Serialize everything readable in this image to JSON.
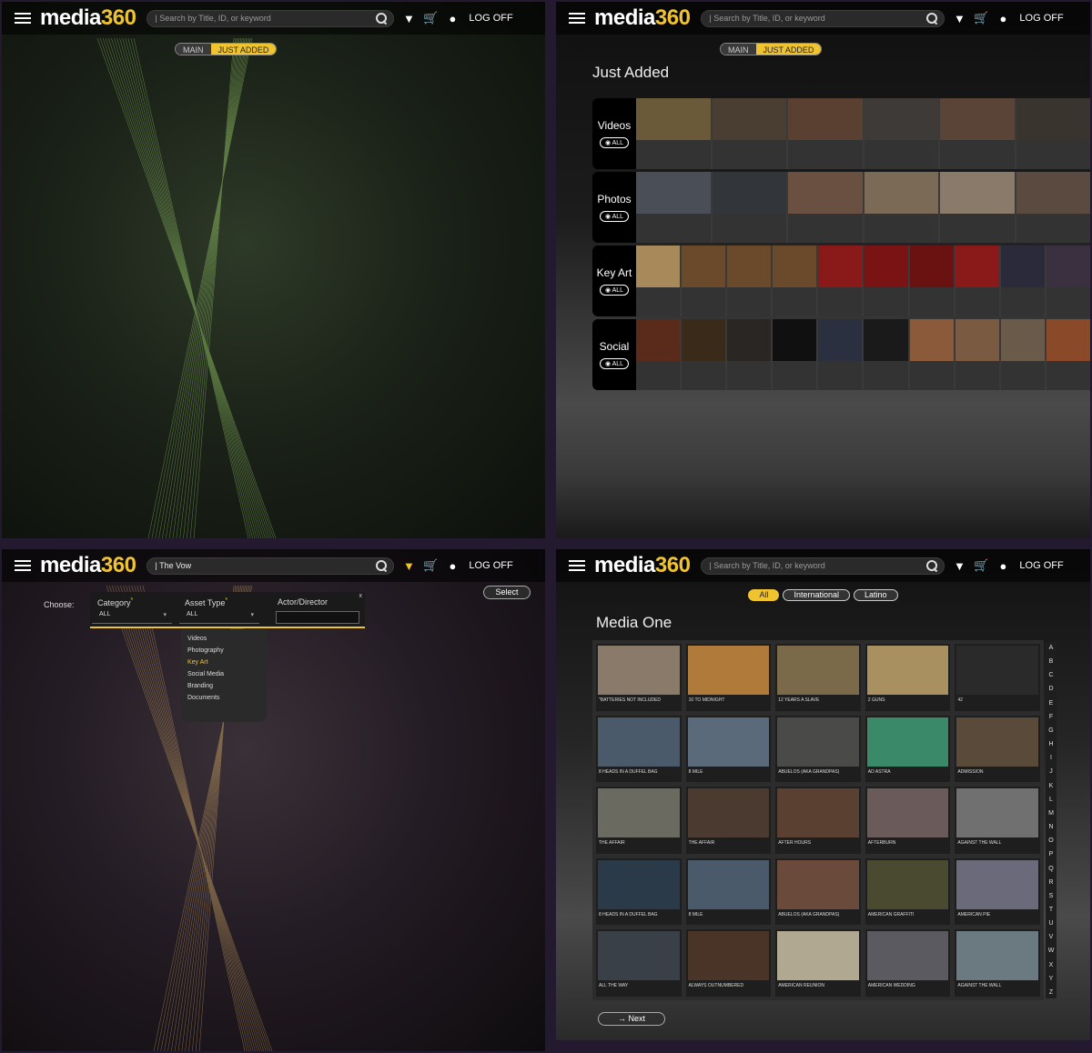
{
  "app": {
    "logo_a": "media",
    "logo_b": "360",
    "logoff": "LOG OFF"
  },
  "screen1": {
    "search_placeholder": "| Search by Title, ID, or keyword",
    "toggle": {
      "main": "MAIN",
      "just_added": "JUST ADDED"
    }
  },
  "screen2": {
    "search_placeholder": "| Search by Title, ID, or keyword",
    "toggle": {
      "main": "MAIN",
      "just_added": "JUST ADDED"
    },
    "title": "Just Added",
    "all_label": "ALL",
    "rows": [
      {
        "label": "Videos",
        "tiles": 6,
        "colors": [
          "#6a5a3a",
          "#4a3e32",
          "#5a4030",
          "#3e3a38",
          "#5a4438",
          "#3a342e"
        ]
      },
      {
        "label": "Photos",
        "tiles": 6,
        "colors": [
          "#4a4e56",
          "#32363a",
          "#6a5040",
          "#7a6a56",
          "#8a7a6a",
          "#5a4a40"
        ]
      },
      {
        "label": "Key Art",
        "tiles": 10,
        "colors": [
          "#a88a5a",
          "#6a4a2a",
          "#6a4a2a",
          "#6a4a2a",
          "#8a1a1a",
          "#7a1414",
          "#6a1212",
          "#8a1a1a",
          "#2a2a3a",
          "#3a3040"
        ]
      },
      {
        "label": "Social",
        "tiles": 10,
        "colors": [
          "#5a2a1a",
          "#3a2a1a",
          "#2a2624",
          "#101010",
          "#2a3040",
          "#1a1a1a",
          "#8a5a3a",
          "#7a5a40",
          "#6a5a4a",
          "#8a4a2a"
        ]
      }
    ]
  },
  "screen3": {
    "search_value": "| The Vow",
    "choose": "Choose:",
    "filters": {
      "category_label": "Category",
      "category_value": "ALL",
      "asset_label": "Asset Type",
      "asset_value": "ALL",
      "actor_label": "Actor/Director",
      "close": "x"
    },
    "asset_options": [
      "Videos",
      "Photography",
      "Key Art",
      "Social Media",
      "Branding",
      "Documents"
    ],
    "asset_highlight": "Key Art",
    "select_button": "Select"
  },
  "screen4": {
    "search_placeholder": "| Search by Title, ID, or keyword",
    "chips": [
      "All",
      "International",
      "Latino"
    ],
    "title": "Media One",
    "titles": [
      "\"BATTERIES NOT INCLUDED",
      "10 TO MIDNIGHT",
      "12 YEARS A SLAVE",
      "2 GUNS",
      "42",
      "8 HEADS IN A DUFFEL BAG",
      "8 MILE",
      "ABUELOS (AKA GRANDPAS)",
      "AD ASTRA",
      "ADMISSION",
      "THE AFFAIR",
      "THE AFFAIR",
      "AFTER HOURS",
      "AFTERBURN",
      "AGAINST THE WALL",
      "8 HEADS IN A DUFFEL BAG",
      "8 MILE",
      "ABUELOS (AKA GRANDPAS)",
      "AMERICAN GRAFFITI",
      "AMERICAN PIE",
      "ALL THE WAY",
      "ALWAYS OUTNUMBERED",
      "AMERICAN REUNION",
      "AMERICAN WEDDING",
      "AGAINST THE WALL"
    ],
    "colors": [
      "#8a7a6a",
      "#b07a3a",
      "#7a6a4a",
      "#a89060",
      "#2a2a2a",
      "#4a5a6a",
      "#5a6a7a",
      "#4a4a48",
      "#3a8a6a",
      "#5a4a3a",
      "#6a6a60",
      "#4a3a30",
      "#5a4030",
      "#6a5a5a",
      "#707070",
      "#2a3a48",
      "#4a5a6a",
      "#6a4a3a",
      "#4a4a30",
      "#6a6a7a",
      "#3a4048",
      "#4a3428",
      "#b0a890",
      "#5a5a60",
      "#6a7a80"
    ],
    "alphabet": [
      "A",
      "B",
      "C",
      "D",
      "E",
      "F",
      "G",
      "H",
      "I",
      "J",
      "K",
      "L",
      "M",
      "N",
      "O",
      "P",
      "Q",
      "R",
      "S",
      "T",
      "U",
      "V",
      "W",
      "X",
      "Y",
      "Z"
    ],
    "next_button": "Next"
  }
}
